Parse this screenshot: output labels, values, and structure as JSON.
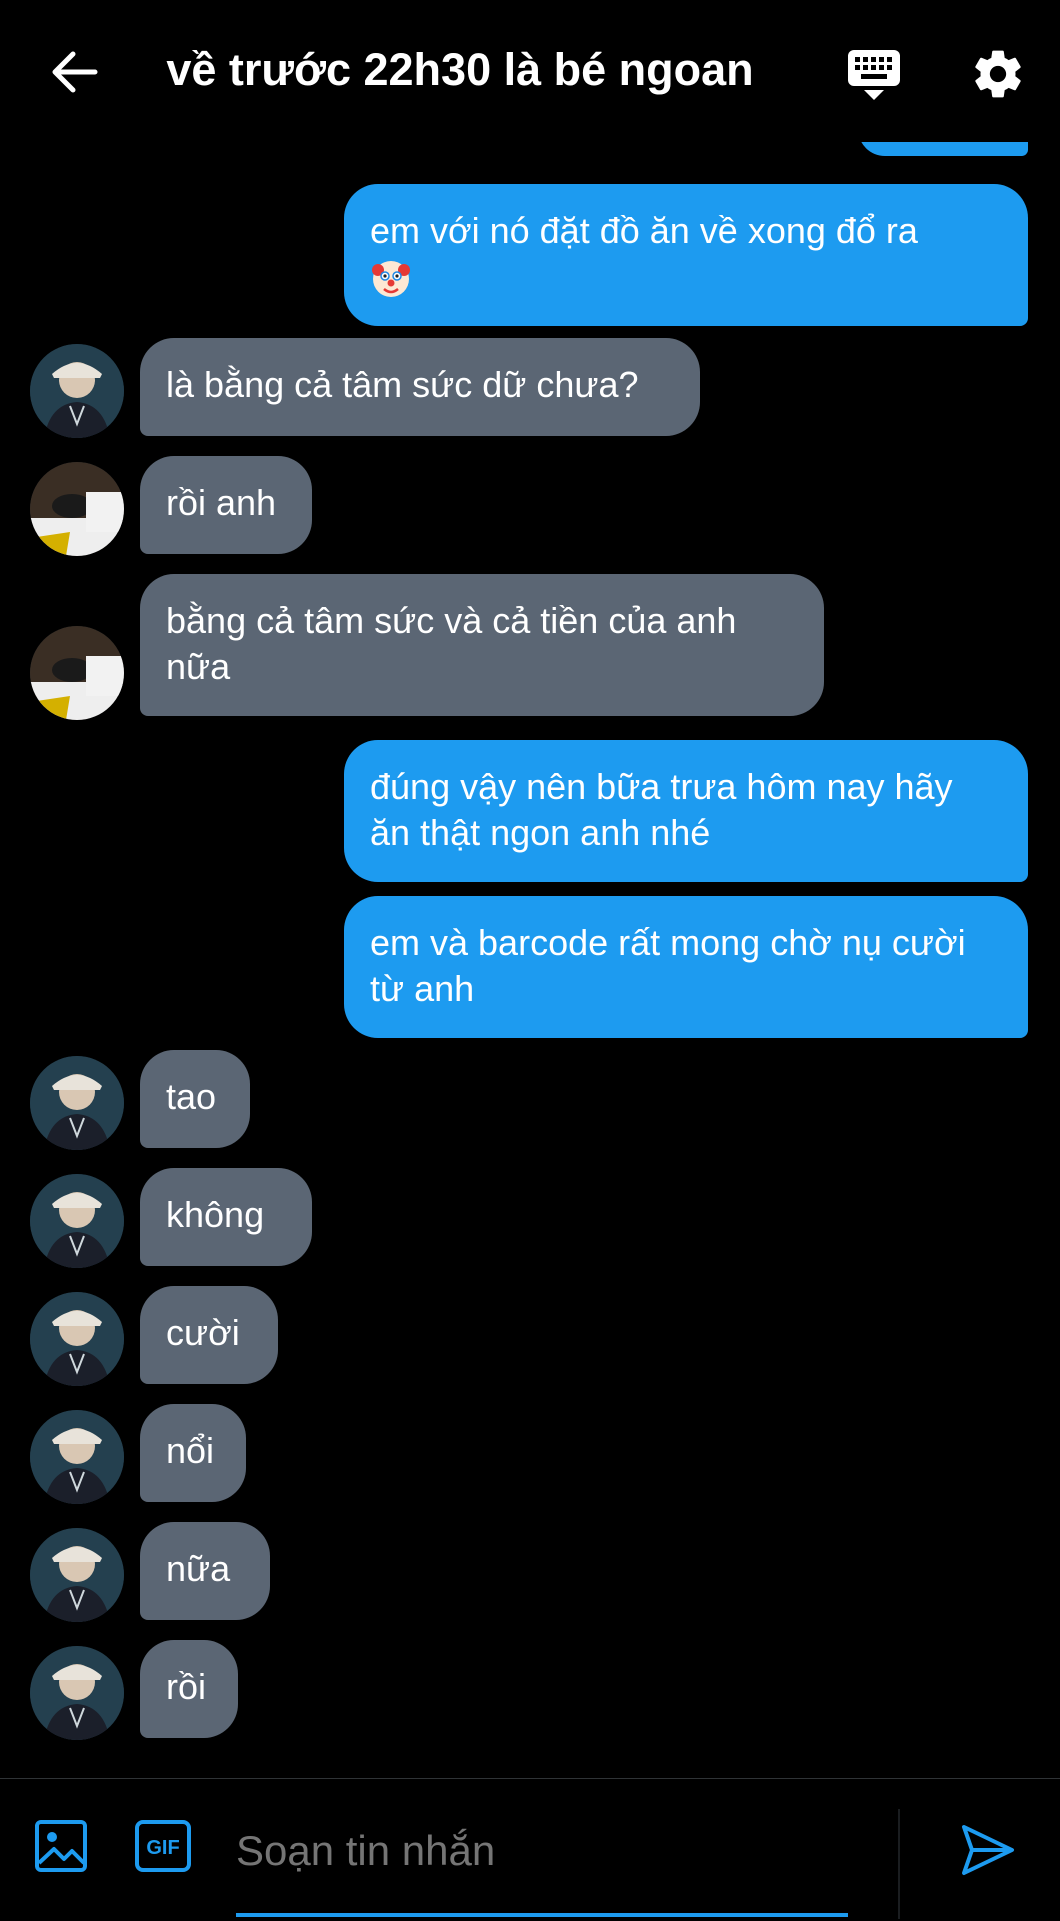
{
  "header": {
    "title": "về trước 22h30 là bé ngoan"
  },
  "messages": [
    {
      "side": "out",
      "text": "em với nó đặt đồ ăn về xong đổ ra",
      "emoji": "clown-face"
    },
    {
      "side": "in",
      "text": "là bằng cả tâm sức dữ chưa?"
    },
    {
      "side": "in",
      "text": "rồi anh"
    },
    {
      "side": "in",
      "text": "bằng cả tâm sức và cả tiền của anh nữa"
    },
    {
      "side": "out",
      "text": "đúng vậy nên bữa trưa hôm nay hãy ăn thật ngon anh nhé"
    },
    {
      "side": "out",
      "text": "em và barcode rất mong chờ nụ cười từ anh"
    },
    {
      "side": "in",
      "text": "tao"
    },
    {
      "side": "in",
      "text": "không"
    },
    {
      "side": "in",
      "text": "cười"
    },
    {
      "side": "in",
      "text": "nổi"
    },
    {
      "side": "in",
      "text": "nữa"
    },
    {
      "side": "in",
      "text": "rồi"
    }
  ],
  "composer": {
    "placeholder": "Soạn tin nhắn",
    "gif_label": "GIF"
  },
  "colors": {
    "accent": "#1d9bf0",
    "incoming_bubble": "#5b6674",
    "background": "#000000"
  }
}
